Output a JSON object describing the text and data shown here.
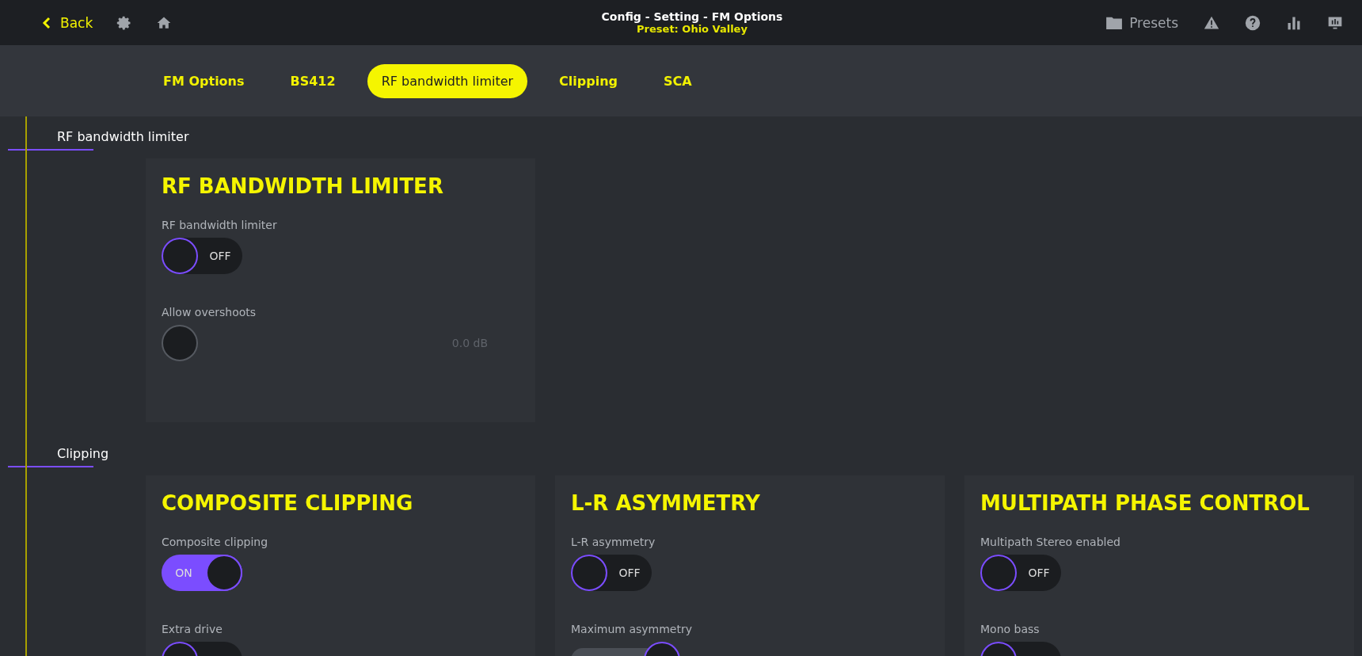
{
  "header": {
    "back": "Back",
    "title": "Config - Setting - FM Options",
    "subtitle": "Preset: Ohio Valley",
    "presets": "Presets"
  },
  "tabs": [
    {
      "label": "FM Options",
      "selected": false
    },
    {
      "label": "BS412",
      "selected": false
    },
    {
      "label": "RF bandwidth limiter",
      "selected": true
    },
    {
      "label": "Clipping",
      "selected": false
    },
    {
      "label": "SCA",
      "selected": false
    }
  ],
  "sections": [
    {
      "heading": "RF bandwidth limiter",
      "cards": [
        {
          "title": "RF BANDWIDTH LIMITER",
          "controls": [
            {
              "kind": "toggle",
              "label": "RF bandwidth limiter",
              "on": false,
              "state_text": "OFF"
            },
            {
              "kind": "slider",
              "label": "Allow overshoots",
              "disabled": true,
              "level": 0,
              "reading": "0.0 dB"
            }
          ]
        }
      ]
    },
    {
      "heading": "Clipping",
      "cards": [
        {
          "title": "COMPOSITE CLIPPING",
          "controls": [
            {
              "kind": "toggle",
              "label": "Composite clipping",
              "on": true,
              "state_text": "ON"
            },
            {
              "kind": "toggle",
              "label": "Extra drive",
              "on": false
            }
          ]
        },
        {
          "title": "L-R ASYMMETRY",
          "controls": [
            {
              "kind": "toggle",
              "label": "L-R asymmetry",
              "on": false,
              "state_text": "OFF"
            },
            {
              "kind": "slider",
              "label": "Maximum asymmetry",
              "disabled": false,
              "level": 0.25
            }
          ]
        },
        {
          "title": "MULTIPATH PHASE CONTROL",
          "controls": [
            {
              "kind": "toggle",
              "label": "Multipath Stereo enabled",
              "on": false,
              "state_text": "OFF"
            },
            {
              "kind": "toggle",
              "label": "Mono bass",
              "on": false
            }
          ]
        }
      ]
    }
  ]
}
